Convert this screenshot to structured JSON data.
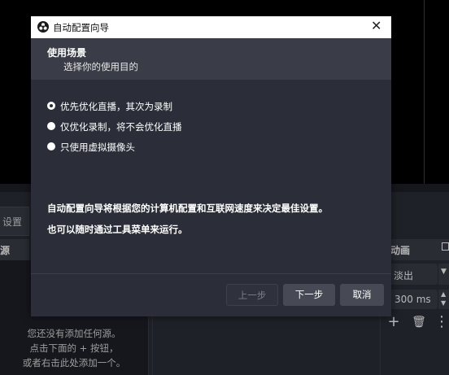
{
  "background": {
    "scene_toolbar_text": "设置",
    "sources_header": "源",
    "sources_empty_lines": [
      "您还没有添加任何源。",
      "点击下面的 + 按钮，",
      "或者右击此处添加一个。"
    ],
    "transitions": {
      "header": "动画",
      "type": "淡出",
      "duration": "300 ms",
      "add_symbol": "+",
      "remove_symbol": "🗑",
      "more_symbol": "⋮"
    }
  },
  "dialog": {
    "title": "自动配置向导",
    "close_symbol": "✕",
    "header_title": "使用场景",
    "header_subtitle": "选择你的使用目的",
    "options": [
      {
        "label": "优先优化直播，其次为录制",
        "selected": true
      },
      {
        "label": "仅优化录制，将不会优化直播",
        "selected": false
      },
      {
        "label": "只使用虚拟摄像头",
        "selected": false
      }
    ],
    "description_lines": [
      "自动配置向导将根据您的计算机配置和互联网速度来决定最佳设置。",
      "也可以随时通过工具菜单来运行。"
    ],
    "buttons": {
      "back": "上一步",
      "next": "下一步",
      "cancel": "取消"
    }
  }
}
